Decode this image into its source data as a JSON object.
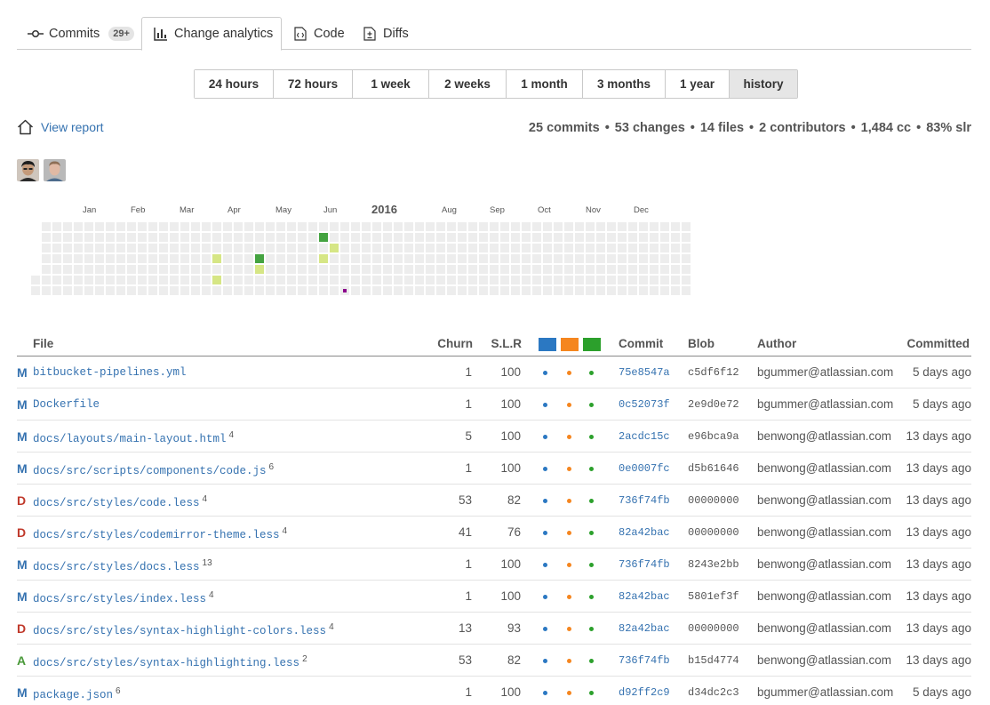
{
  "tabs": [
    {
      "label": "Commits",
      "badge": "29+",
      "icon": "commit-icon"
    },
    {
      "label": "Change analytics",
      "icon": "bar-chart-icon"
    },
    {
      "label": "Code",
      "icon": "code-file-icon"
    },
    {
      "label": "Diffs",
      "icon": "diff-file-icon"
    }
  ],
  "ranges": [
    "24 hours",
    "72 hours",
    "1 week",
    "2 weeks",
    "1 month",
    "3 months",
    "1 year",
    "history"
  ],
  "active_range": "history",
  "report": {
    "view_label": "View report",
    "icon": "home-icon"
  },
  "summary": {
    "commits": "25 commits",
    "changes": "53 changes",
    "files": "14 files",
    "contributors": "2 contributors",
    "cc": "1,484 cc",
    "slr": "83% slr",
    "separator": "•"
  },
  "avatars": [
    "contributor-avatar-1",
    "contributor-avatar-2"
  ],
  "heatmap": {
    "year": "2016",
    "months": [
      "Jan",
      "Feb",
      "Mar",
      "Apr",
      "May",
      "Jun",
      "Aug",
      "Sep",
      "Oct",
      "Nov",
      "Dec"
    ],
    "colors": {
      "empty": "#ededed",
      "light": "#d6e685",
      "dark": "#44a340",
      "marker": "#8b008b"
    }
  },
  "table": {
    "headers": {
      "file": "File",
      "churn": "Churn",
      "slr": "S.L.R",
      "commit": "Commit",
      "blob": "Blob",
      "author": "Author",
      "committed": "Committed"
    },
    "legend_colors": [
      "#2b78c2",
      "#f5861f",
      "#2ca02c"
    ],
    "rows": [
      {
        "status": "M",
        "file": "bitbucket-pipelines.yml",
        "sup": "",
        "churn": "1",
        "slr": "100",
        "commit": "75e8547a",
        "blob": "c5df6f12",
        "author": "bgummer@atlassian.com",
        "committed": "5 days ago"
      },
      {
        "status": "M",
        "file": "Dockerfile",
        "sup": "",
        "churn": "1",
        "slr": "100",
        "commit": "0c52073f",
        "blob": "2e9d0e72",
        "author": "bgummer@atlassian.com",
        "committed": "5 days ago"
      },
      {
        "status": "M",
        "file": "docs/layouts/main-layout.html",
        "sup": "4",
        "churn": "5",
        "slr": "100",
        "commit": "2acdc15c",
        "blob": "e96bca9a",
        "author": "benwong@atlassian.com",
        "committed": "13 days ago"
      },
      {
        "status": "M",
        "file": "docs/src/scripts/components/code.js",
        "sup": "6",
        "churn": "1",
        "slr": "100",
        "commit": "0e0007fc",
        "blob": "d5b61646",
        "author": "benwong@atlassian.com",
        "committed": "13 days ago"
      },
      {
        "status": "D",
        "file": "docs/src/styles/code.less",
        "sup": "4",
        "churn": "53",
        "slr": "82",
        "commit": "736f74fb",
        "blob": "00000000",
        "author": "benwong@atlassian.com",
        "committed": "13 days ago"
      },
      {
        "status": "D",
        "file": "docs/src/styles/codemirror-theme.less",
        "sup": "4",
        "churn": "41",
        "slr": "76",
        "commit": "82a42bac",
        "blob": "00000000",
        "author": "benwong@atlassian.com",
        "committed": "13 days ago"
      },
      {
        "status": "M",
        "file": "docs/src/styles/docs.less",
        "sup": "13",
        "churn": "1",
        "slr": "100",
        "commit": "736f74fb",
        "blob": "8243e2bb",
        "author": "benwong@atlassian.com",
        "committed": "13 days ago"
      },
      {
        "status": "M",
        "file": "docs/src/styles/index.less",
        "sup": "4",
        "churn": "1",
        "slr": "100",
        "commit": "82a42bac",
        "blob": "5801ef3f",
        "author": "benwong@atlassian.com",
        "committed": "13 days ago"
      },
      {
        "status": "D",
        "file": "docs/src/styles/syntax-highlight-colors.less",
        "sup": "4",
        "churn": "13",
        "slr": "93",
        "commit": "82a42bac",
        "blob": "00000000",
        "author": "benwong@atlassian.com",
        "committed": "13 days ago"
      },
      {
        "status": "A",
        "file": "docs/src/styles/syntax-highlighting.less",
        "sup": "2",
        "churn": "53",
        "slr": "82",
        "commit": "736f74fb",
        "blob": "b15d4774",
        "author": "benwong@atlassian.com",
        "committed": "13 days ago"
      },
      {
        "status": "M",
        "file": "package.json",
        "sup": "6",
        "churn": "1",
        "slr": "100",
        "commit": "d92ff2c9",
        "blob": "d34dc2c3",
        "author": "bgummer@atlassian.com",
        "committed": "5 days ago"
      }
    ]
  }
}
